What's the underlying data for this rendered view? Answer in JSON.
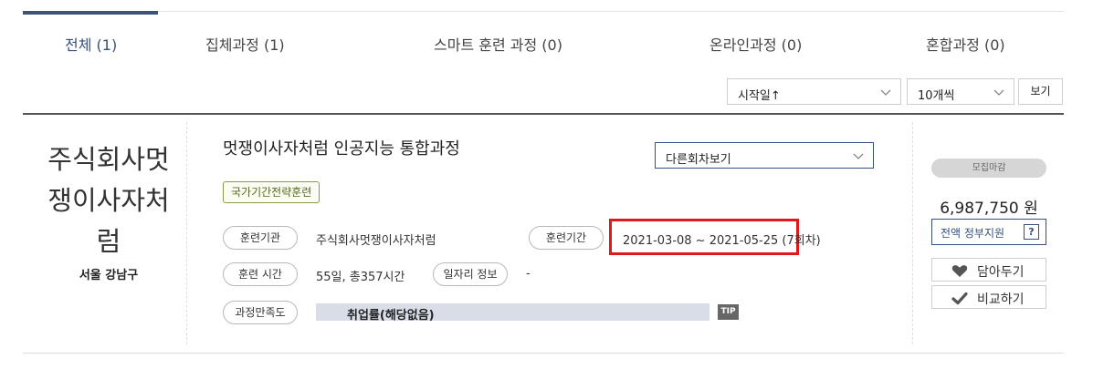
{
  "tabs": [
    {
      "label": "전체 (1)",
      "active": true
    },
    {
      "label": "집체과정 (1)",
      "active": false
    },
    {
      "label": "스마트 훈련 과정 (0)",
      "active": false
    },
    {
      "label": "온라인과정 (0)",
      "active": false
    },
    {
      "label": "혼합과정 (0)",
      "active": false
    }
  ],
  "controls": {
    "sort_value": "시작일↑",
    "count_value": "10개씩",
    "view_button": "보기"
  },
  "course": {
    "org_name": "주식회사멋쟁이사자처럼",
    "org_location": "서울 강남구",
    "title": "멋쟁이사자처럼 인공지능 통합과정",
    "round_select": "다른회차보기",
    "badge": "국가기간전략훈련",
    "labels": {
      "org": "훈련기관",
      "period": "훈련기간",
      "hours": "훈련 시간",
      "job_info": "일자리 정보",
      "satisfaction": "과정만족도"
    },
    "org_value": "주식회사멋쟁이사자처럼",
    "period_value": "2021-03-08 ~ 2021-05-25 (7회차)",
    "hours_value": "55일, 총357시간",
    "job_info_value": "-",
    "employment_rate": "취업률(해당없음)",
    "tip": "TIP"
  },
  "side": {
    "status": "모집마감",
    "price": "6,987,750 원",
    "gov_support": "전액 정부지원",
    "help": "?",
    "wishlist": "담아두기",
    "compare": "비교하기"
  },
  "colors": {
    "accent": "#34507e",
    "highlight_box": "#e0191b"
  }
}
